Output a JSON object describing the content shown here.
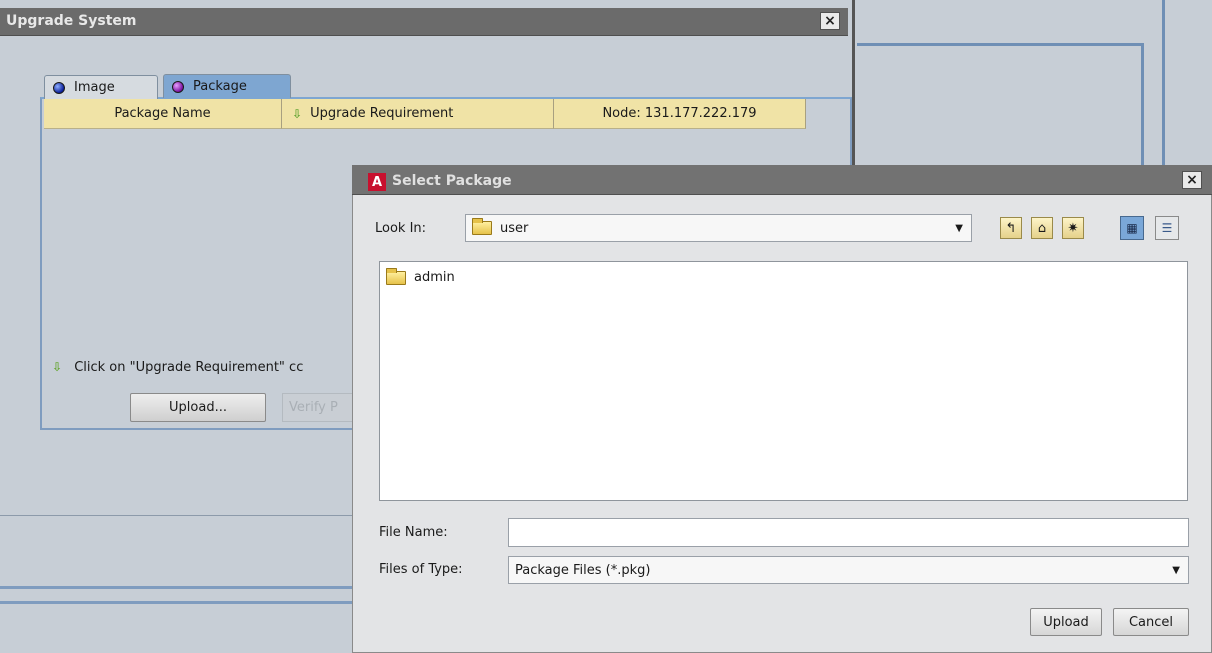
{
  "upgrade_window": {
    "title": "Upgrade System",
    "close": "×",
    "tabs": [
      {
        "label": "Image",
        "active": false
      },
      {
        "label": "Package",
        "active": true
      }
    ],
    "table": {
      "columns": [
        "Package Name",
        "Upgrade Requirement",
        "Node: 131.177.222.179"
      ]
    },
    "hint": "Click on \"Upgrade Requirement\" cc",
    "upload_button": "Upload...",
    "verify_button": "Verify P"
  },
  "dialog": {
    "title": "Select Package",
    "close": "×",
    "look_in_label": "Look In:",
    "look_in_value": "user",
    "toolbar_icons": [
      "up-folder-icon",
      "home-icon",
      "new-folder-icon",
      "list-view-icon",
      "details-view-icon"
    ],
    "files": [
      {
        "name": "admin",
        "type": "folder"
      }
    ],
    "file_name_label": "File Name:",
    "file_name_value": "",
    "files_of_type_label": "Files of Type:",
    "files_of_type_value": "Package Files (*.pkg)",
    "upload_button": "Upload",
    "cancel_button": "Cancel"
  },
  "colors": {
    "title_bar": "#727272",
    "panel_border": "#7f9cbf",
    "header_fill": "#f0e3a6",
    "accent_red": "#c8102e"
  }
}
